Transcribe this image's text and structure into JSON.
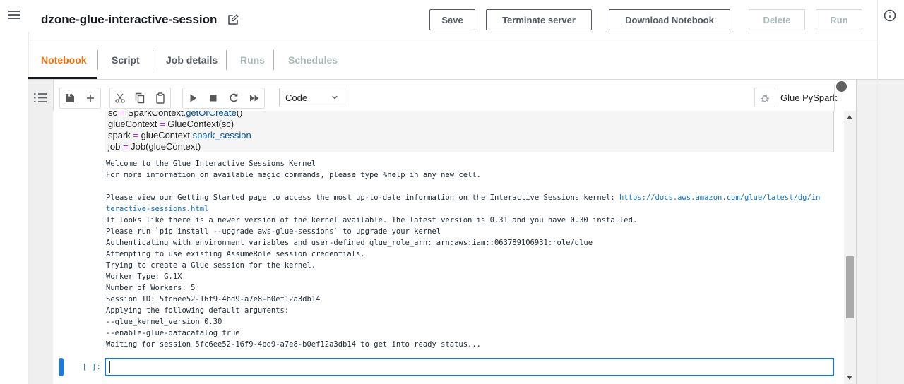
{
  "header": {
    "title": "dzone-glue-interactive-session",
    "buttons": [
      {
        "id": "save",
        "label": "Save",
        "enabled": true
      },
      {
        "id": "terminate-server",
        "label": "Terminate server",
        "enabled": true
      },
      {
        "id": "download-notebook",
        "label": "Download Notebook",
        "enabled": true
      },
      {
        "id": "delete",
        "label": "Delete",
        "enabled": false
      },
      {
        "id": "run",
        "label": "Run",
        "enabled": false
      }
    ]
  },
  "tabs": [
    {
      "id": "notebook",
      "label": "Notebook",
      "state": "active"
    },
    {
      "id": "script",
      "label": "Script",
      "state": "enabled"
    },
    {
      "id": "job-details",
      "label": "Job details",
      "state": "enabled"
    },
    {
      "id": "runs",
      "label": "Runs",
      "state": "disabled"
    },
    {
      "id": "schedules",
      "label": "Schedules",
      "state": "disabled"
    }
  ],
  "notebook_toolbar": {
    "cell_type_selector": "Code",
    "kernel_name": "Glue PySpark"
  },
  "icons": {
    "hamburger-icon": "three horizontal bars",
    "edit-icon": "pencil in square",
    "info-icon": "circled i",
    "toc-icon": "bulleted list",
    "save-icon": "floppy disk",
    "add-cell-icon": "plus",
    "cut-icon": "scissors",
    "copy-icon": "two pages",
    "paste-icon": "clipboard",
    "run-cell-icon": "play triangle",
    "stop-icon": "solid square",
    "restart-kernel-icon": "circular arrow",
    "run-all-icon": "double play triangle",
    "chevron-down-icon": "v chevron",
    "debugger-icon": "bug",
    "kernel-status-icon": "filled circle"
  },
  "code_cell": {
    "lines": [
      [
        {
          "t": "sc ",
          "c": "plain"
        },
        {
          "t": "=",
          "c": "op"
        },
        {
          "t": " SparkContext",
          "c": "plain"
        },
        {
          "t": ".getOrCreate",
          "c": "prop"
        },
        {
          "t": "()",
          "c": "plain"
        }
      ],
      [
        {
          "t": "glueContext ",
          "c": "plain"
        },
        {
          "t": "=",
          "c": "op"
        },
        {
          "t": " GlueContext(sc)",
          "c": "plain"
        }
      ],
      [
        {
          "t": "spark ",
          "c": "plain"
        },
        {
          "t": "=",
          "c": "op"
        },
        {
          "t": " glueContext",
          "c": "plain"
        },
        {
          "t": ".spark_session",
          "c": "prop"
        }
      ],
      [
        {
          "t": "job ",
          "c": "plain"
        },
        {
          "t": "=",
          "c": "op"
        },
        {
          "t": " Job(glueContext)",
          "c": "plain"
        }
      ]
    ]
  },
  "output_lines": [
    [
      {
        "t": "Welcome to the Glue Interactive Sessions Kernel"
      }
    ],
    [
      {
        "t": "For more information on available magic commands, please type %help in any new cell."
      }
    ],
    [],
    [
      {
        "t": "Please view our Getting Started page to access the most up-to-date information on the Interactive Sessions kernel: "
      },
      {
        "t": "https://docs.aws.amazon.com/glue/latest/dg/in",
        "link": true
      }
    ],
    [
      {
        "t": "teractive-sessions.html",
        "link": true
      }
    ],
    [
      {
        "t": "It looks like there is a newer version of the kernel available. The latest version is 0.31 and you have 0.30 installed."
      }
    ],
    [
      {
        "t": "Please run `pip install --upgrade aws-glue-sessions` to upgrade your kernel"
      }
    ],
    [
      {
        "t": "Authenticating with environment variables and user-defined glue_role_arn: arn:aws:iam::063789106931:role/glue"
      }
    ],
    [
      {
        "t": "Attempting to use existing AssumeRole session credentials."
      }
    ],
    [
      {
        "t": "Trying to create a Glue session for the kernel."
      }
    ],
    [
      {
        "t": "Worker Type: G.1X"
      }
    ],
    [
      {
        "t": "Number of Workers: 5"
      }
    ],
    [
      {
        "t": "Session ID: 5fc6ee52-16f9-4bd9-a7e8-b0ef12a3db14"
      }
    ],
    [
      {
        "t": "Applying the following default arguments:"
      }
    ],
    [
      {
        "t": "--glue_kernel_version 0.30"
      }
    ],
    [
      {
        "t": "--enable-glue-datacatalog true"
      }
    ],
    [
      {
        "t": "Waiting for session 5fc6ee52-16f9-4bd9-a7e8-b0ef12a3db14 to get into ready status..."
      }
    ]
  ],
  "empty_cell": {
    "prompt": "[ ]:",
    "value": ""
  },
  "colors": {
    "accent_orange": "#ec7211",
    "active_cell_blue": "#2074d5",
    "link_blue": "#0b76d1",
    "prompt_blue": "#307fc1",
    "operator_purple": "#aa22ff",
    "property_blue": "#0055aa",
    "kernel_busy_gray": "#616161"
  }
}
